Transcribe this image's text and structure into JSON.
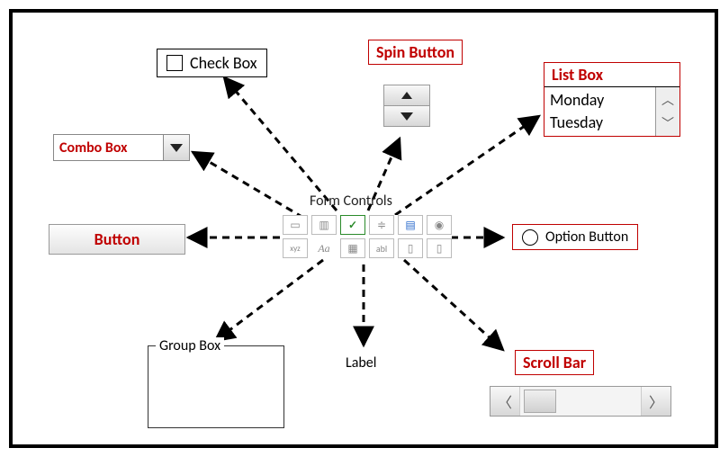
{
  "labels": {
    "check_box": "Check Box",
    "spin_button": "Spin Button",
    "list_box": "List Box",
    "combo_box": "Combo Box",
    "button": "Button",
    "option_button": "Option Button",
    "group_box": "Group Box",
    "label": "Label",
    "scroll_bar": "Scroll Bar",
    "palette_title": "Form Controls"
  },
  "listbox": {
    "items": [
      "Monday",
      "Tuesday"
    ]
  },
  "palette_row2": {
    "xyz": "xyz",
    "aa": "Aa",
    "abl": "abl"
  }
}
